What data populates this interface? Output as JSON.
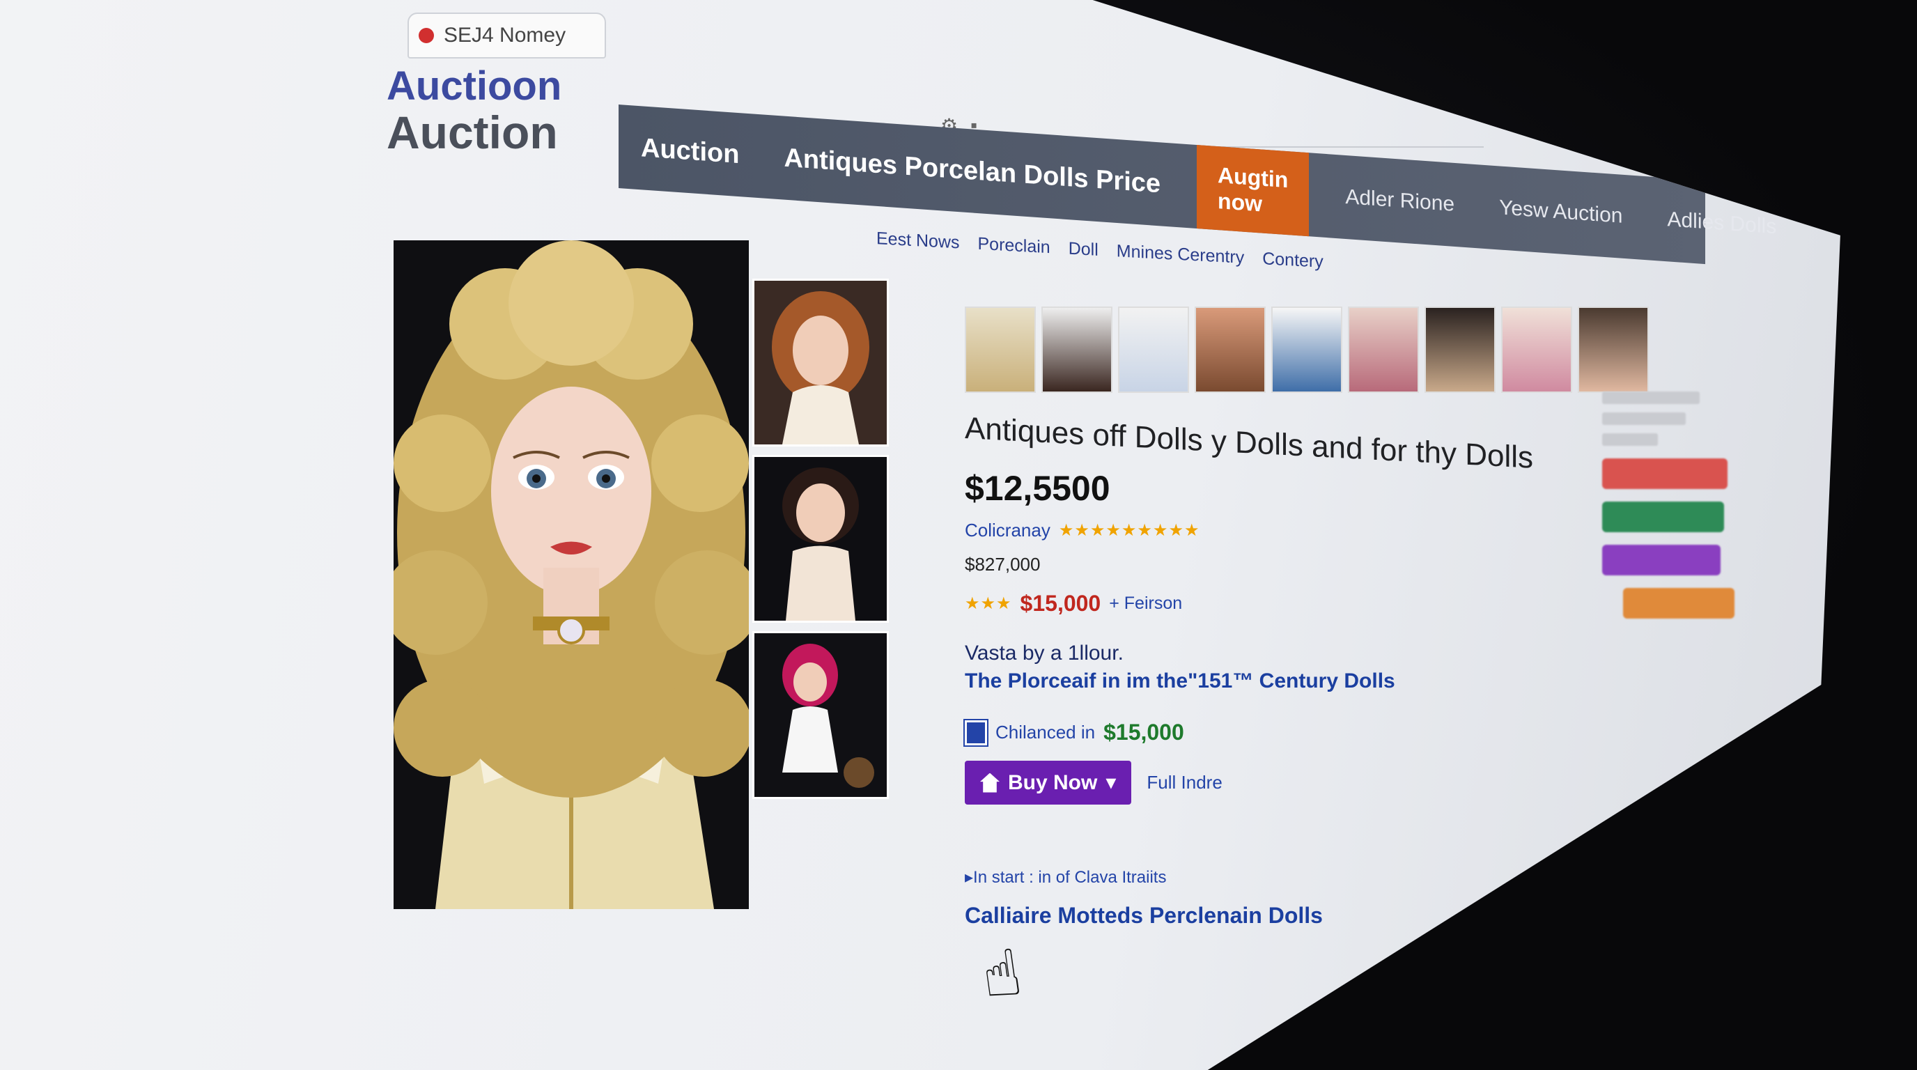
{
  "browser": {
    "tab_title": "SEJ4 Nomey",
    "tab_favicon": "red-circle-icon",
    "address_icons": [
      "settings-icon",
      "lock-icon"
    ]
  },
  "logo": {
    "line1": "Auctioon",
    "line2": "Auction"
  },
  "navbar": {
    "items": [
      {
        "label": "Auction"
      },
      {
        "label": "Antiques Porcelan Dolls Price"
      }
    ],
    "cta_label": "Augtin now",
    "secondary_items": [
      {
        "label": "Adler Rione"
      },
      {
        "label": "Yesw Auction"
      },
      {
        "label": "Adlies Dolls"
      }
    ]
  },
  "subnav": {
    "items": [
      {
        "label": "Eest Nows"
      },
      {
        "label": "Poreclain"
      },
      {
        "label": "Doll"
      },
      {
        "label": "Mnines Cerentry"
      },
      {
        "label": "Contery"
      }
    ]
  },
  "product": {
    "title": "Antiques off Dolls y Dolls and for thy Dolls",
    "price_main": "$12,5500",
    "seller": "Colicranay",
    "seller_stars": "★★★★★★★★★",
    "price_secondary": "$827,000",
    "rating_stars": "★★★",
    "price_highlight": "$15,000",
    "price_suffix": "+ Feirson",
    "desc_line1": "Vasta by a 1llour.",
    "desc_line2": "The Plorceaif in im the\"151™ Century Dolls",
    "shipping_label": "Chilanced in",
    "shipping_price": "$15,000",
    "buy_label": "Buy Now",
    "full_link": "Full Indre",
    "in_start": "▸In start : in of Clava Itraiits",
    "collection_link": "Calliaire Motteds Perclenain Dolls"
  },
  "colors": {
    "nav_bg": "#4c5566",
    "cta_orange": "#d4601a",
    "buy_purple": "#6a1fb0",
    "link_blue": "#2344a8",
    "price_red": "#c0271e",
    "ship_green": "#1e7a2c"
  }
}
